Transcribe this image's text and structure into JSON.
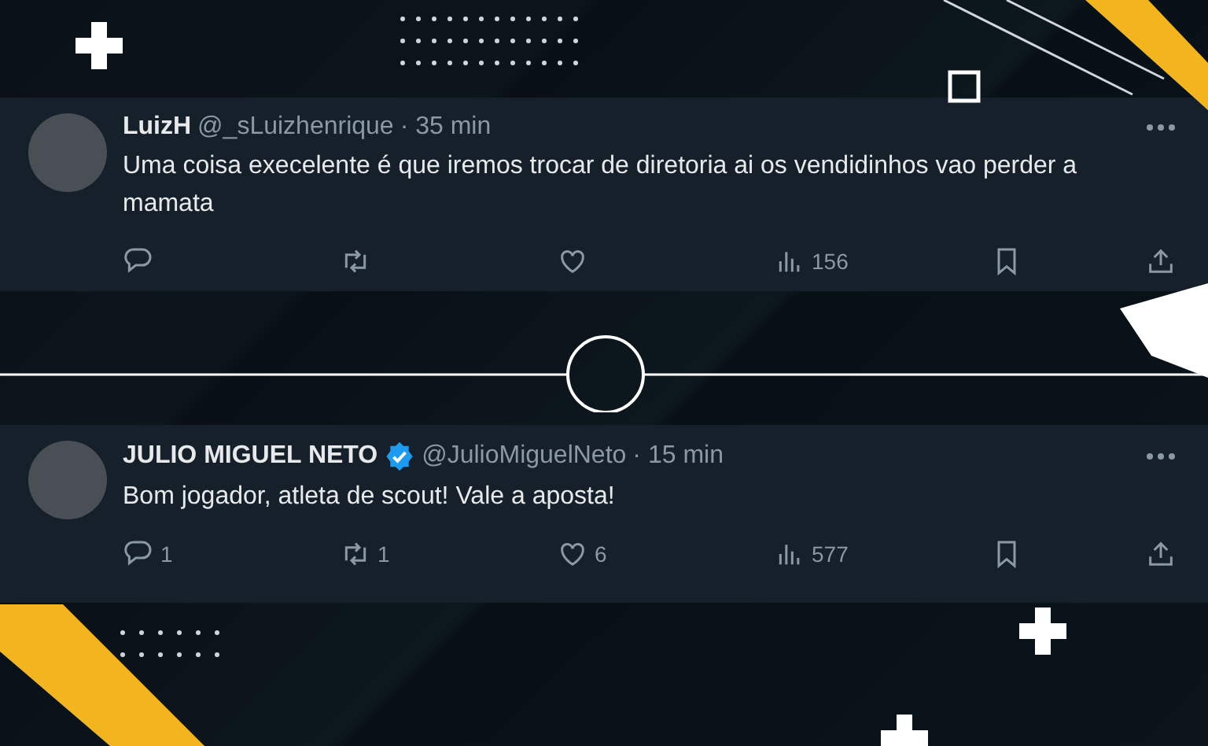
{
  "tweets": [
    {
      "name": "LuizH",
      "verified": false,
      "handle": "@_sLuizhenrique",
      "time": "· 35 min",
      "text": "Uma coisa execelente é que iremos trocar de diretoria ai os vendidinhos vao perder a mamata",
      "actions": [
        {
          "kind": "reply"
        },
        {
          "kind": "retweet"
        },
        {
          "kind": "like"
        },
        {
          "kind": "views",
          "count": "156"
        },
        {
          "kind": "bookmark"
        },
        {
          "kind": "share"
        }
      ]
    },
    {
      "name": "JULIO MIGUEL NETO",
      "verified": true,
      "handle": "@JulioMiguelNeto",
      "time": "· 15 min",
      "text": "Bom jogador, atleta de scout! Vale a aposta!",
      "actions": [
        {
          "kind": "reply",
          "count": "1"
        },
        {
          "kind": "retweet",
          "count": "1"
        },
        {
          "kind": "like",
          "count": "6"
        },
        {
          "kind": "views",
          "count": "577"
        },
        {
          "kind": "bookmark"
        },
        {
          "kind": "share"
        }
      ]
    }
  ]
}
